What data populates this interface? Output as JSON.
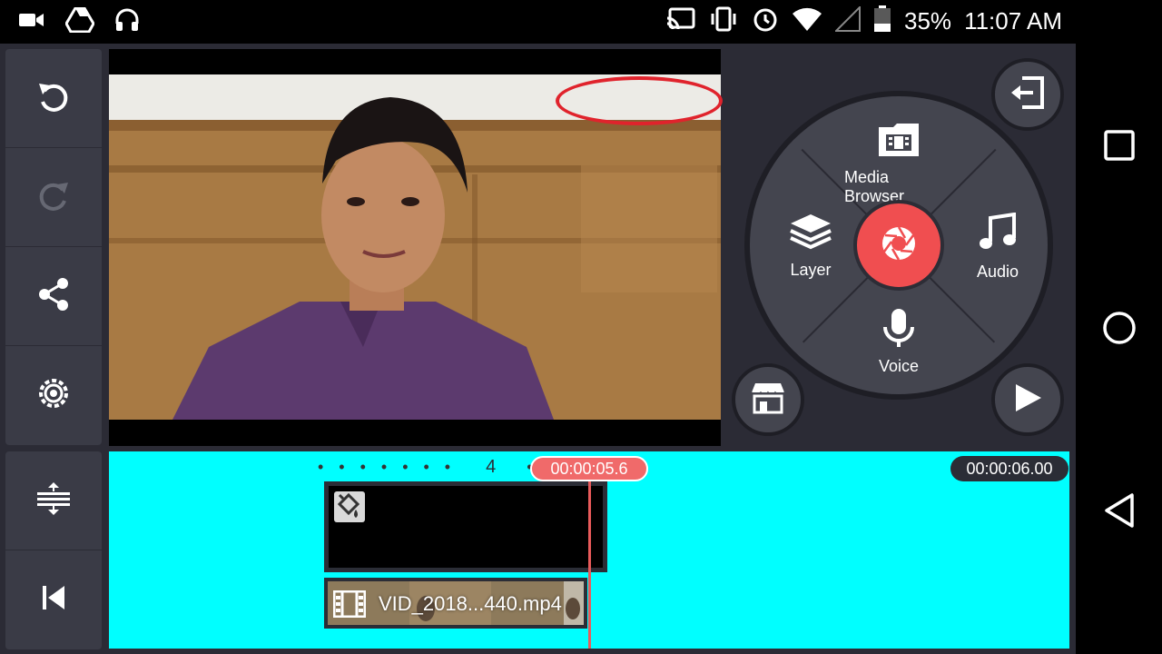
{
  "status_bar": {
    "battery": "35%",
    "time": "11:07 AM",
    "left_icons": [
      "camera-icon",
      "drive-icon",
      "headset-icon"
    ],
    "right_icons": [
      "cast-icon",
      "vibrate-icon",
      "alarm-icon",
      "wifi-icon",
      "no-signal-icon",
      "battery-icon"
    ]
  },
  "left_toolbar": {
    "buttons": [
      "undo-icon",
      "redo-icon",
      "share-icon",
      "settings-icon",
      "timeline-expand-icon",
      "skip-to-start-icon"
    ]
  },
  "wheel": {
    "media_browser": "Media Browser",
    "layer": "Layer",
    "audio": "Audio",
    "voice": "Voice",
    "center_icon": "camera-shutter-icon"
  },
  "round_buttons": {
    "exit_icon": "exit-icon",
    "store_icon": "store-icon",
    "play_icon": "play-icon"
  },
  "timeline": {
    "marker_number": "4",
    "current_time": "00:00:05.6",
    "end_time": "00:00:06.00",
    "video_clip_name": "VID_2018...440.mp4"
  },
  "colors": {
    "timeline_bg": "#00ffff",
    "accent_red": "#f04e50",
    "panel": "#3a3b46"
  }
}
